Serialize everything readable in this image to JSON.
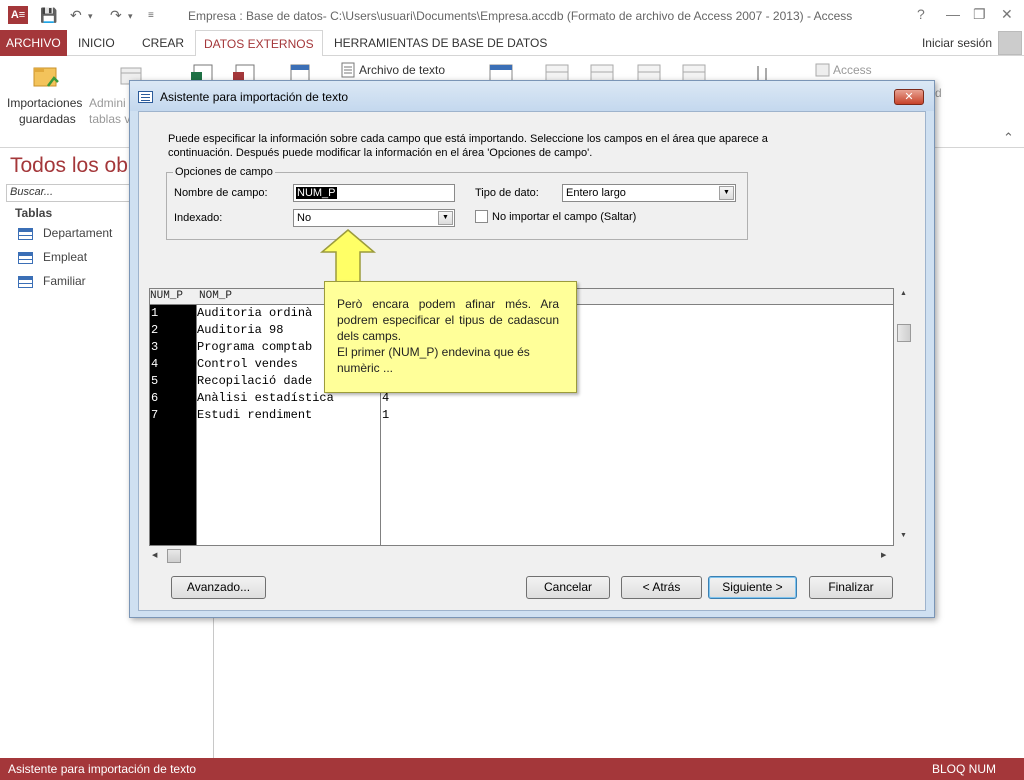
{
  "window": {
    "app_badge": "A≡",
    "title": "Empresa : Base de datos- C:\\Users\\usuari\\Documents\\Empresa.accdb (Formato de archivo de Access 2007 - 2013) - Access",
    "help": "?",
    "minimize": "—",
    "restore": "❐",
    "close": "✕"
  },
  "tabs": {
    "file": "ARCHIVO",
    "items": [
      "INICIO",
      "CREAR",
      "DATOS EXTERNOS",
      "HERRAMIENTAS DE BASE DE DATOS"
    ],
    "active": "DATOS EXTERNOS",
    "signin": "Iniciar sesión"
  },
  "ribbon": {
    "saved_imports_line1": "Importaciones",
    "saved_imports_line2": "guardadas",
    "linked_tables_line1": "Admini",
    "linked_tables_line2": "tablas v",
    "text_file": "Archivo de texto",
    "access": "Access",
    "partial_right": "d"
  },
  "nav": {
    "title": "Todos los ob",
    "search_placeholder": "Buscar...",
    "group": "Tablas",
    "items": [
      "Departament",
      "Empleat",
      "Familiar"
    ]
  },
  "status": {
    "left": "Asistente para importación de texto",
    "right": "BLOQ NUM"
  },
  "dialog": {
    "title": "Asistente para importación de texto",
    "close": "✕",
    "intro_line1": "Puede especificar la información sobre cada campo que está importando. Seleccione los campos en el área que aparece a",
    "intro_line2": "continuación. Después puede modificar la información en el área 'Opciones de campo'.",
    "field_options": {
      "legend": "Opciones de campo",
      "field_name_label": "Nombre de campo:",
      "field_name_value": "NUM_P",
      "data_type_label": "Tipo de dato:",
      "data_type_value": "Entero largo",
      "indexed_label": "Indexado:",
      "indexed_value": "No",
      "skip_label": "No importar el campo (Saltar)",
      "skip_checked": false
    },
    "grid": {
      "headers": [
        "NUM_P",
        "NOM_P",
        ""
      ],
      "rows": [
        [
          "1",
          "Auditoria ordinà",
          ""
        ],
        [
          "2",
          "Auditoria 98",
          ""
        ],
        [
          "3",
          "Programa comptab",
          ""
        ],
        [
          "4",
          "Control vendes",
          ""
        ],
        [
          "5",
          "Recopilació dade",
          ""
        ],
        [
          "6",
          "Anàlisi estadística",
          "4"
        ],
        [
          "7",
          "Estudi rendiment",
          "1"
        ]
      ]
    },
    "buttons": {
      "advanced": "Avanzado...",
      "cancel": "Cancelar",
      "back": "< Atrás",
      "next": "Siguiente >",
      "finish": "Finalizar"
    }
  },
  "callout": {
    "line1": "Però encara podem afinar més. Ara podrem especificar el tipus de cadascun dels camps.",
    "line2": "El primer (NUM_P) endevina que és numèric ..."
  },
  "colors": {
    "access_red": "#a4373a",
    "callout_yellow": "#ffff99",
    "dialog_blue": "#cfe0f1"
  }
}
